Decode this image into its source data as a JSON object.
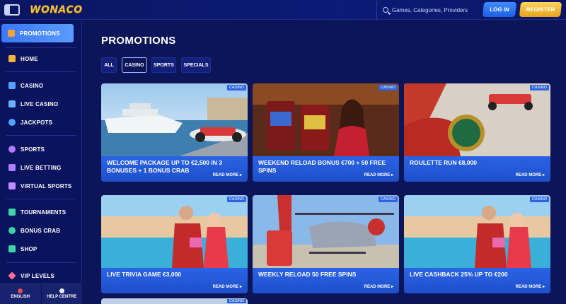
{
  "header": {
    "logo": "WONACO",
    "search_placeholder": "Games, Categories, Providers",
    "login": "LOG IN",
    "register": "REGISTER"
  },
  "sidebar": {
    "items": [
      {
        "label": "PROMOTIONS",
        "icon": "gift-icon",
        "active": true
      },
      {
        "label": "HOME",
        "icon": "home-icon"
      },
      {
        "label": "CASINO",
        "icon": "casino-icon"
      },
      {
        "label": "LIVE CASINO",
        "icon": "live-casino-icon"
      },
      {
        "label": "JACKPOTS",
        "icon": "jackpot-icon"
      },
      {
        "label": "SPORTS",
        "icon": "sports-icon"
      },
      {
        "label": "LIVE BETTING",
        "icon": "live-betting-icon"
      },
      {
        "label": "VIRTUAL SPORTS",
        "icon": "virtual-sports-icon"
      },
      {
        "label": "TOURNAMENTS",
        "icon": "trophy-icon"
      },
      {
        "label": "BONUS CRAB",
        "icon": "crab-icon"
      },
      {
        "label": "SHOP",
        "icon": "shop-icon"
      },
      {
        "label": "VIP LEVELS",
        "icon": "diamond-icon"
      }
    ],
    "footer": {
      "language": "ENGLISH",
      "help": "HELP CENTRE"
    }
  },
  "main": {
    "title": "PROMOTIONS",
    "filters": [
      "ALL",
      "CASINO",
      "SPORTS",
      "SPECIALS"
    ],
    "selected_filter": "CASINO",
    "read_more": "READ MORE",
    "cards": [
      {
        "badge": "CASINO",
        "title": "WELCOME PACKAGE UP TO €2,500 IN 3 BONUSES + 1 BONUS CRAB"
      },
      {
        "badge": "CASINO",
        "title": "WEEKEND RELOAD BONUS €700 + 50 FREE SPINS"
      },
      {
        "badge": "CASINO",
        "title": "ROULETTE RUN €8,000"
      },
      {
        "badge": "CASINO",
        "title": "LIVE TRIVIA GAME €3,000"
      },
      {
        "badge": "CASINO",
        "title": "WEEKLY RELOAD 50 FREE SPINS"
      },
      {
        "badge": "CASINO",
        "title": "LIVE CASHBACK 25% UP TO €200"
      }
    ],
    "partial_card_badge": "CASINO"
  },
  "colors": {
    "background": "#0b1554",
    "accent_blue": "#2a63e6",
    "register_gold": "#f0b22a"
  }
}
